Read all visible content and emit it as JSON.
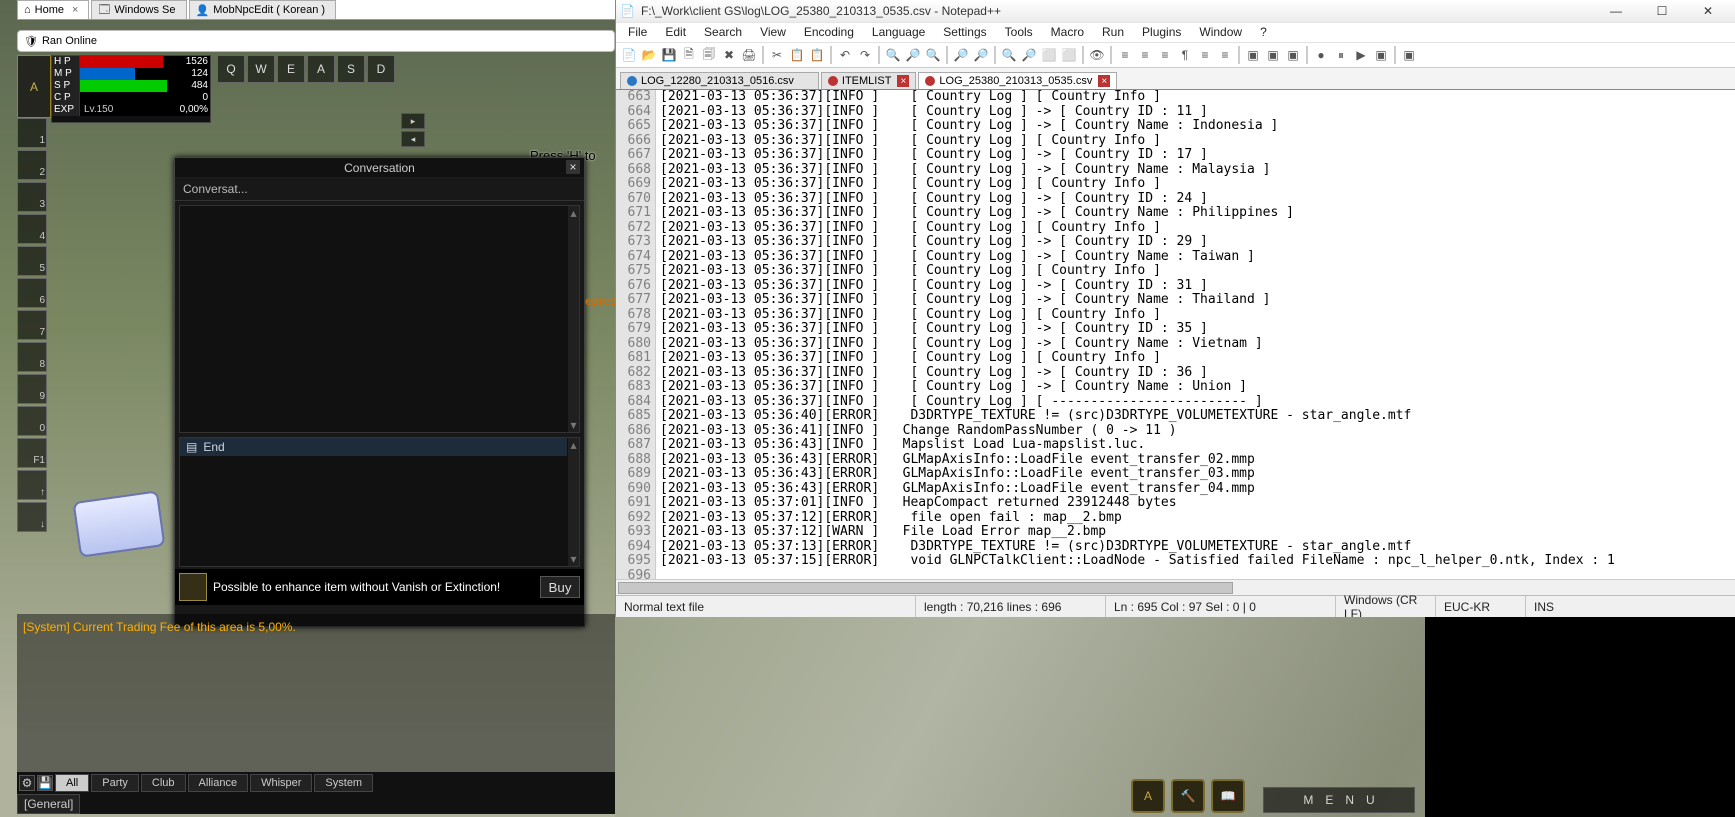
{
  "browser_tabs": [
    {
      "icon": "home",
      "label": "Home"
    },
    {
      "icon": "win",
      "label": "Windows Se"
    },
    {
      "icon": "app",
      "label": "MobNpcEdit ( Korean )"
    }
  ],
  "url_label": "Ran Online",
  "stats": {
    "hp": {
      "label": "H P",
      "value": "1526"
    },
    "mp": {
      "label": "M P",
      "value": "124"
    },
    "sp": {
      "label": "S P",
      "value": "484"
    },
    "cp": {
      "label": "C P",
      "value": "0"
    },
    "exp_label": "EXP",
    "lv_label": "Lv.150",
    "exp_pct": "0,00%"
  },
  "hotkeys": [
    "Q",
    "W",
    "E",
    "A",
    "S",
    "D"
  ],
  "action_numbers": [
    "1",
    "2",
    "3",
    "4",
    "5",
    "6",
    "7",
    "8",
    "9",
    "0",
    "F1",
    "↑",
    "↓"
  ],
  "help_tip": "Press 'H' to view",
  "conversation": {
    "title": "Conversation",
    "sub": "Conversat...",
    "end": "End",
    "footer": "Possible to enhance item without Vanish or Extinction!",
    "buy": "Buy"
  },
  "chat": {
    "line": "[System] Current Trading Fee of this area is 5,00%.",
    "tabs": [
      "All",
      "Party",
      "Club",
      "Alliance",
      "Whisper",
      "System"
    ],
    "input_label": "[General]"
  },
  "npc_tag": "epres",
  "npp": {
    "title": "F:\\_Work\\client GS\\log\\LOG_25380_210313_0535.csv - Notepad++",
    "menu": [
      "File",
      "Edit",
      "Search",
      "View",
      "Encoding",
      "Language",
      "Settings",
      "Tools",
      "Macro",
      "Run",
      "Plugins",
      "Window",
      "?"
    ],
    "tabs": [
      {
        "name": "LOG_12280_210313_0516.csv",
        "active": false,
        "saved": true
      },
      {
        "name": "ITEMLIST",
        "active": false,
        "saved": false
      },
      {
        "name": "LOG_25380_210313_0535.csv",
        "active": true,
        "saved": false
      }
    ],
    "lines": [
      "[2021-03-13 05:36:37][INFO ]    [ Country Log ] [ Country Info ]",
      "[2021-03-13 05:36:37][INFO ]    [ Country Log ] -> [ Country ID : 11 ]",
      "[2021-03-13 05:36:37][INFO ]    [ Country Log ] -> [ Country Name : Indonesia ]",
      "[2021-03-13 05:36:37][INFO ]    [ Country Log ] [ Country Info ]",
      "[2021-03-13 05:36:37][INFO ]    [ Country Log ] -> [ Country ID : 17 ]",
      "[2021-03-13 05:36:37][INFO ]    [ Country Log ] -> [ Country Name : Malaysia ]",
      "[2021-03-13 05:36:37][INFO ]    [ Country Log ] [ Country Info ]",
      "[2021-03-13 05:36:37][INFO ]    [ Country Log ] -> [ Country ID : 24 ]",
      "[2021-03-13 05:36:37][INFO ]    [ Country Log ] -> [ Country Name : Philippines ]",
      "[2021-03-13 05:36:37][INFO ]    [ Country Log ] [ Country Info ]",
      "[2021-03-13 05:36:37][INFO ]    [ Country Log ] -> [ Country ID : 29 ]",
      "[2021-03-13 05:36:37][INFO ]    [ Country Log ] -> [ Country Name : Taiwan ]",
      "[2021-03-13 05:36:37][INFO ]    [ Country Log ] [ Country Info ]",
      "[2021-03-13 05:36:37][INFO ]    [ Country Log ] -> [ Country ID : 31 ]",
      "[2021-03-13 05:36:37][INFO ]    [ Country Log ] -> [ Country Name : Thailand ]",
      "[2021-03-13 05:36:37][INFO ]    [ Country Log ] [ Country Info ]",
      "[2021-03-13 05:36:37][INFO ]    [ Country Log ] -> [ Country ID : 35 ]",
      "[2021-03-13 05:36:37][INFO ]    [ Country Log ] -> [ Country Name : Vietnam ]",
      "[2021-03-13 05:36:37][INFO ]    [ Country Log ] [ Country Info ]",
      "[2021-03-13 05:36:37][INFO ]    [ Country Log ] -> [ Country ID : 36 ]",
      "[2021-03-13 05:36:37][INFO ]    [ Country Log ] -> [ Country Name : Union ]",
      "[2021-03-13 05:36:37][INFO ]    [ Country Log ] [ ------------------------- ]",
      "[2021-03-13 05:36:40][ERROR]    D3DRTYPE_TEXTURE != (src)D3DRTYPE_VOLUMETEXTURE - star_angle.mtf",
      "[2021-03-13 05:36:41][INFO ]   Change RandomPassNumber ( 0 -> 11 )",
      "[2021-03-13 05:36:43][INFO ]   Mapslist Load Lua-mapslist.luc.",
      "[2021-03-13 05:36:43][ERROR]   GLMapAxisInfo::LoadFile event_transfer_02.mmp",
      "[2021-03-13 05:36:43][ERROR]   GLMapAxisInfo::LoadFile event_transfer_03.mmp",
      "[2021-03-13 05:36:43][ERROR]   GLMapAxisInfo::LoadFile event_transfer_04.mmp",
      "[2021-03-13 05:37:01][INFO ]   HeapCompact returned 23912448 bytes",
      "[2021-03-13 05:37:12][ERROR]    file open fail : map__2.bmp",
      "[2021-03-13 05:37:12][WARN ]   File Load Error map__2.bmp",
      "[2021-03-13 05:37:13][ERROR]    D3DRTYPE_TEXTURE != (src)D3DRTYPE_VOLUMETEXTURE - star_angle.mtf",
      "[2021-03-13 05:37:15][ERROR]    void GLNPCTalkClient::LoadNode - Satisfied failed FileName : npc_l_helper_0.ntk, Index : 1",
      ""
    ],
    "first_line_no": 663,
    "status": {
      "mode": "Normal text file",
      "length": "length : 70,216    lines : 696",
      "pos": "Ln : 695    Col : 97    Sel : 0 | 0",
      "eol": "Windows (CR LF)",
      "enc": "EUC-KR",
      "ins": "INS"
    }
  },
  "menu_btn": "MENU"
}
